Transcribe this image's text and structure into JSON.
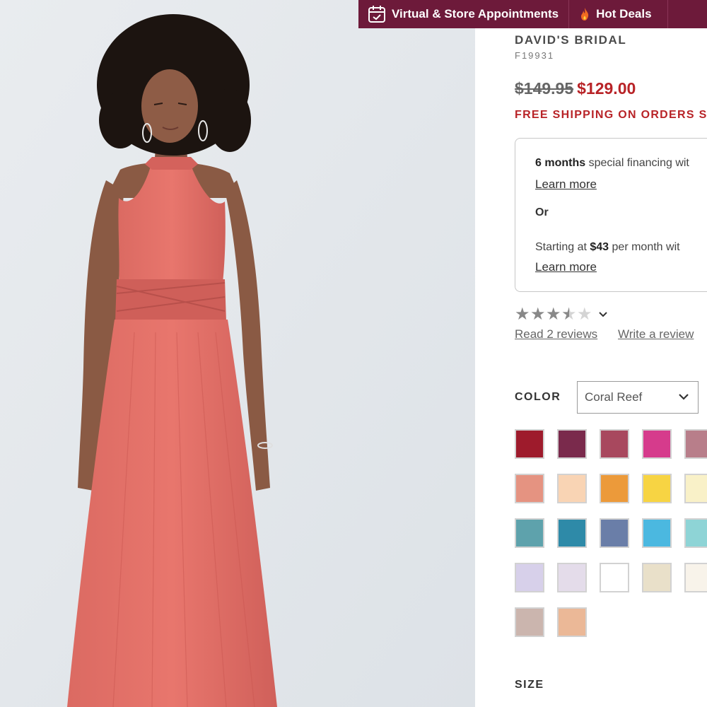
{
  "promo": {
    "appointments_label": "Virtual & Store Appointments",
    "deals_label": "Hot Deals"
  },
  "product": {
    "brand": "DAVID'S BRIDAL",
    "sku": "F19931",
    "price_original": "$149.95",
    "price_sale": "$129.00",
    "shipping": "FREE SHIPPING ON ORDERS S"
  },
  "financing": {
    "line1_bold": "6 months",
    "line1_rest": " special financing wit",
    "learn_more_1": "Learn more",
    "or": "Or",
    "line2_pre": "Starting at ",
    "line2_bold": "$43",
    "line2_rest": " per month wit",
    "learn_more_2": "Learn more"
  },
  "reviews": {
    "rating": 3.5,
    "max": 5,
    "read_link": "Read 2 reviews",
    "write_link": "Write a review"
  },
  "color": {
    "label": "COLOR",
    "selected": "Coral Reef",
    "swatches": [
      [
        "#9e1b2c",
        "#7a2a4c",
        "#a8485e",
        "#d63b8c",
        "#b87e8a"
      ],
      [
        "#e59381",
        "#f9d4b4",
        "#ec9a3a",
        "#f7d443",
        "#f9f1c8"
      ],
      [
        "#5ea2ac",
        "#2e8aa8",
        "#6a7ea8",
        "#4bb8e0",
        "#8ed4d6"
      ],
      [
        "#d7d0ea",
        "#e4dcea",
        "#ffffff",
        "#e9e0c9",
        "#f8f3ea"
      ],
      [
        "#cbb5ae",
        "#ebb897"
      ]
    ]
  },
  "size": {
    "label": "SIZE"
  }
}
